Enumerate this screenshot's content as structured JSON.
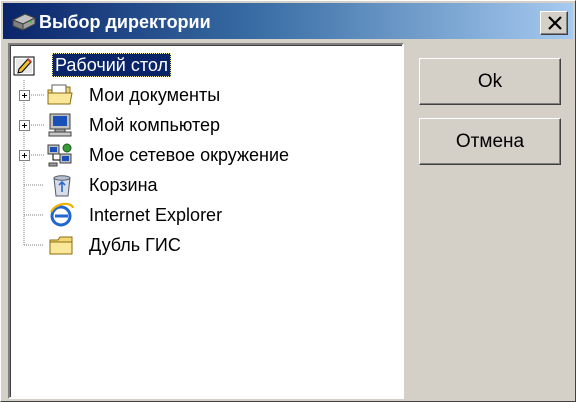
{
  "window": {
    "title": "Выбор директории",
    "title_icon": "drive-folder-icon",
    "close_label": "close"
  },
  "tree": {
    "root": {
      "label": "Рабочий стол",
      "icon": "desktop-icon",
      "selected": true
    },
    "items": [
      {
        "label": "Мои документы",
        "icon": "my-documents-folder-icon",
        "expandable": true
      },
      {
        "label": "Мой компьютер",
        "icon": "my-computer-icon",
        "expandable": true
      },
      {
        "label": "Мое сетевое окружение",
        "icon": "network-places-icon",
        "expandable": true
      },
      {
        "label": "Корзина",
        "icon": "recycle-bin-icon",
        "expandable": false
      },
      {
        "label": "Internet Explorer",
        "icon": "internet-explorer-icon",
        "expandable": false
      },
      {
        "label": "Дубль ГИС",
        "icon": "folder-icon",
        "expandable": false
      }
    ]
  },
  "buttons": {
    "ok_label": "Ok",
    "cancel_label": "Отмена"
  },
  "colors": {
    "selection": "#0a246a",
    "title_gradient_start": "#0a246a",
    "title_gradient_end": "#a6caf0",
    "face": "#d4d0c8"
  }
}
